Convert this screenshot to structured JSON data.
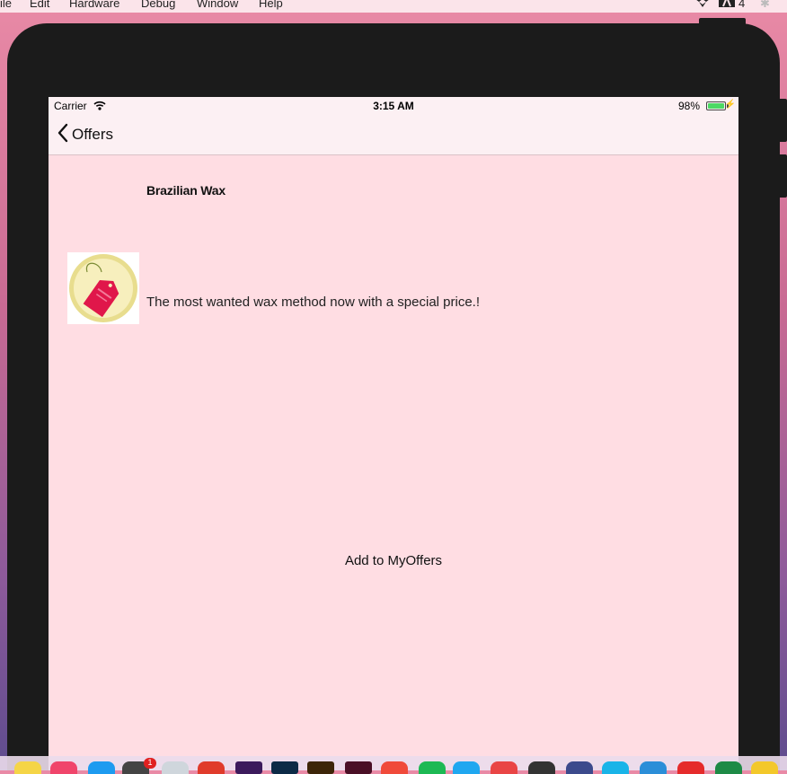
{
  "menubar": {
    "items": [
      "ile",
      "Edit",
      "Hardware",
      "Debug",
      "Window",
      "Help"
    ],
    "right_count": "4"
  },
  "status_bar": {
    "carrier": "Carrier",
    "time": "3:15 AM",
    "battery_percent": "98%",
    "battery_level": 0.98
  },
  "nav": {
    "back_label": "Offers"
  },
  "offer": {
    "title": "Brazilian Wax",
    "description": "The most wanted wax method now with a special price.!",
    "thumbnail_icon": "price-tag-icon"
  },
  "actions": {
    "add_label": "Add to MyOffers"
  },
  "colors": {
    "screen_bg": "#ffdde3",
    "bar_bg": "#fcf0f3",
    "battery": "#4cd964",
    "tag": "#e0174a",
    "medallion": "#f3e7a0"
  },
  "dock": {
    "icons": [
      "notes-icon",
      "itunes-icon",
      "appstore-icon",
      "activity-monitor-icon",
      "safari-icon",
      "photo-booth-icon",
      "premiere-icon",
      "photoshop-icon",
      "illustrator-icon",
      "indesign-icon",
      "calendar-app-icon",
      "spotify-icon",
      "messages-icon",
      "calendar-icon",
      "clapper-icon",
      "unknown-icon",
      "skype-icon",
      "vscode-icon",
      "acrobat-icon",
      "excel-icon",
      "chrome-icon"
    ],
    "badge": "1"
  }
}
